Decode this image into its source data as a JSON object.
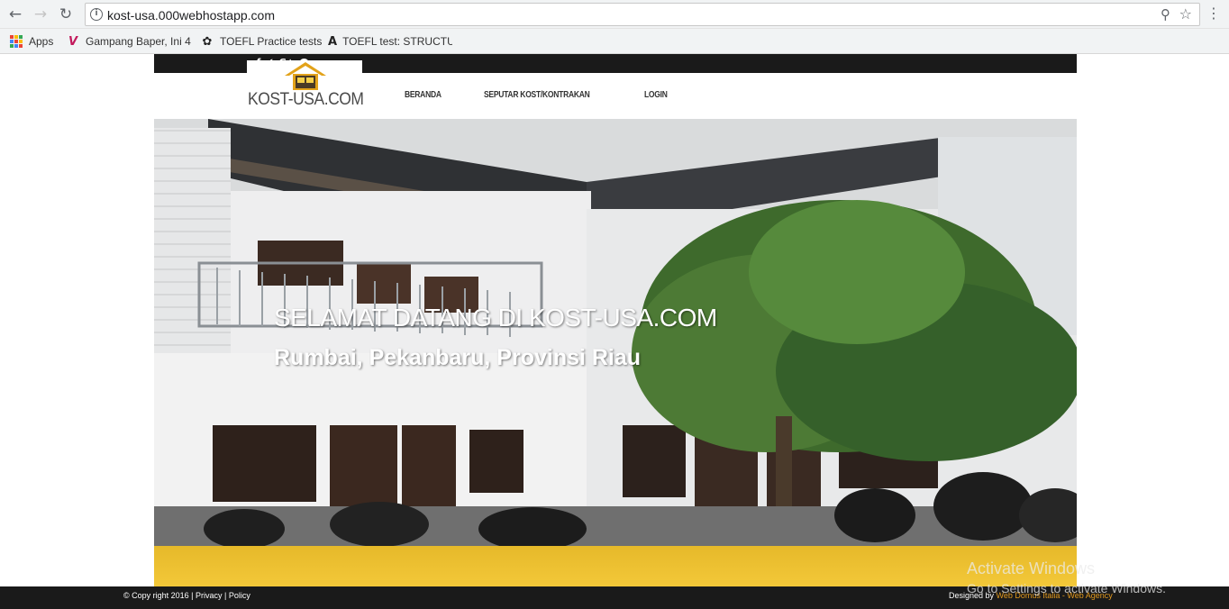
{
  "browser": {
    "url": "kost-usa.000webhostapp.com",
    "bookmarks": [
      {
        "label": "Apps",
        "icon": "apps-grid-icon"
      },
      {
        "label": "Gampang Baper, Ini 4",
        "icon": "v-logo-icon"
      },
      {
        "label": "TOEFL Practice tests",
        "icon": "toefl-logo-icon"
      },
      {
        "label": "TOEFL test: STRUCTU",
        "icon": "toefl-a-icon"
      }
    ]
  },
  "site": {
    "logo_text": "KOST-USA.COM",
    "nav": [
      "BERANDA",
      "SEPUTAR KOST/KONTRAKAN",
      "LOGIN"
    ],
    "social_icons": [
      "facebook-icon",
      "twitter-icon",
      "google-plus-icon",
      "pinterest-icon"
    ],
    "hero": {
      "title": "SELAMAT DATANG DI KOST-USA.COM",
      "subtitle": "Rumbai, Pekanbaru, Provinsi Riau"
    },
    "footer": {
      "copyright": "© Copy right 2016 | Privacy | Policy",
      "designed_by": "Designed by ",
      "agency": "Web Domus Italia - Web Agency"
    }
  },
  "os": {
    "watermark_title": "Activate Windows",
    "watermark_sub": "Go to Settings to activate Windows."
  },
  "colors": {
    "topbar": "#1a1a1a",
    "accent_yellow": "#f3c839",
    "logo_roof": "#e2a21a",
    "agency_link": "#e39a1e"
  }
}
